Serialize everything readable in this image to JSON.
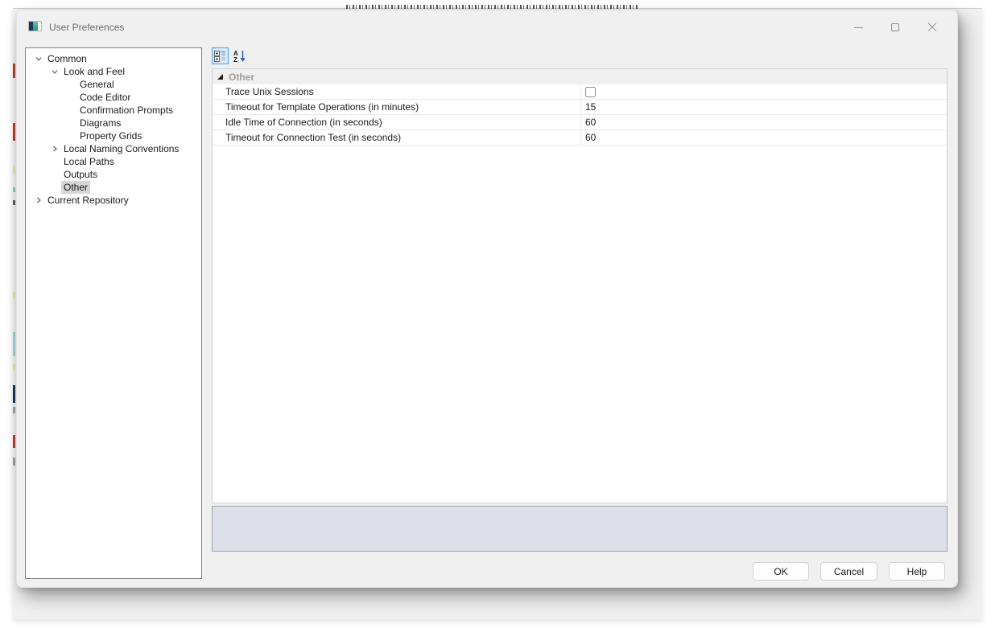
{
  "window": {
    "title": "User Preferences",
    "controls": {
      "minimize": "minimize",
      "maximize": "maximize",
      "close": "close"
    }
  },
  "background_window": {
    "note_fragment": "clipped text sliver of window behind dialog",
    "sliver_colors": [
      "#c0392b",
      "#e9e5a6",
      "#7fccc9",
      "#17375e",
      "#9aa0a6"
    ]
  },
  "tree": {
    "items": [
      {
        "label": "Common",
        "level": 0,
        "state": "expanded",
        "selected": false
      },
      {
        "label": "Look and Feel",
        "level": 1,
        "state": "expanded",
        "selected": false
      },
      {
        "label": "General",
        "level": 2,
        "state": "leaf",
        "selected": false
      },
      {
        "label": "Code Editor",
        "level": 2,
        "state": "leaf",
        "selected": false
      },
      {
        "label": "Confirmation Prompts",
        "level": 2,
        "state": "leaf",
        "selected": false
      },
      {
        "label": "Diagrams",
        "level": 2,
        "state": "leaf",
        "selected": false
      },
      {
        "label": "Property Grids",
        "level": 2,
        "state": "leaf",
        "selected": false
      },
      {
        "label": "Local Naming Conventions",
        "level": 1,
        "state": "collapsed",
        "selected": false
      },
      {
        "label": "Local Paths",
        "level": 1,
        "state": "leaf",
        "selected": false
      },
      {
        "label": "Outputs",
        "level": 1,
        "state": "leaf",
        "selected": false
      },
      {
        "label": "Other",
        "level": 1,
        "state": "leaf",
        "selected": true
      },
      {
        "label": "Current Repository",
        "level": 0,
        "state": "collapsed",
        "selected": false
      }
    ]
  },
  "property_grid": {
    "toolbar": {
      "categorized_button": "categorized-view",
      "alphabetical_button": "alphabetical-sort",
      "categorized_active": true
    },
    "category": "Other",
    "rows": [
      {
        "label": "Trace Unix Sessions",
        "type": "checkbox",
        "checked": false,
        "value": ""
      },
      {
        "label": "Timeout for Template Operations (in minutes)",
        "type": "text",
        "value": "15"
      },
      {
        "label": "Idle Time of Connection (in seconds)",
        "type": "text",
        "value": "60"
      },
      {
        "label": "Timeout for Connection Test (in seconds)",
        "type": "text",
        "value": "60"
      }
    ],
    "description_text": ""
  },
  "buttons": {
    "ok": "OK",
    "cancel": "Cancel",
    "help": "Help"
  },
  "colors": {
    "dialog_bg": "#f0f0f0",
    "panel_bg": "#ffffff",
    "description_bg": "#dde0e9",
    "selection_bg": "#d6d6d6",
    "category_text": "#9c9c9c",
    "toolbar_active_border": "#4f9ee0",
    "toolbar_active_bg": "#d9eafa"
  }
}
